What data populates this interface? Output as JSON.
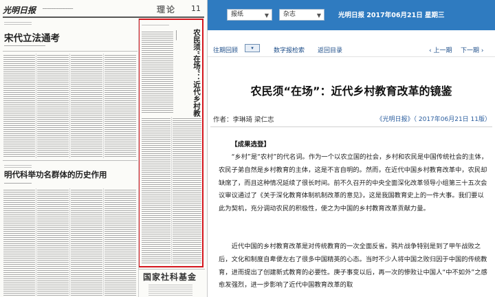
{
  "newspaper": {
    "masthead": "光明日报",
    "section": "理论",
    "page_no": "11",
    "headline_1": "宋代立法通考",
    "headline_2": "明代科举功名群体的历史作用",
    "highlight_title": "农民须“在场”：近代乡村教育改革的镜鉴",
    "ad": "国家社科基金"
  },
  "toolbar": {
    "paper_select": "报纸",
    "type_select": "杂志",
    "date_line": "光明日报  2017年06月21日  星期三"
  },
  "nav": {
    "back_label": "往期回顾",
    "period_icon": "▾",
    "search_label": "数字报检索",
    "catalog_label": "返回目录",
    "prev_label": "‹ 上一期",
    "next_label": "下一期 ›"
  },
  "article": {
    "title": "农民须“在场”：近代乡村教育改革的镜鉴",
    "authors": "作者：李琳琦  梁仁志",
    "source": "《光明日报》（ 2017年06月21日  11版）",
    "section_tag": "【成果选登】",
    "paragraphs": [
      "“乡村”是“农村”的代名词。作为一个以农立国的社会，乡村和农民是中国传统社会的主体，农民子弟自然是乡村教育的主体，这是不言自明的。然而，在近代中国乡村教育改革中，农民却缺席了，而且这种情况延续了很长时间。前不久召开的中央全面深化改革领导小组第三十五次会议审议通过了《关于深化教育体制机制改革的意见》，这是我国教育史上的一件大事。我们要以此为契机，充分调动农民的积极性，使之为中国的乡村教育改革贡献力量。",
      "近代中国的乡村教育改革是对传统教育的一次全面反省。鸦片战争特别是到了甲午战败之后，文化和制度自卑便左右了很多中国精英的心态。当时不少人将中国之败归因于中国的传统教育，进而提出了创建新式教育的必要性。庚子事变以后，再一次的惨败让中国人“中不如外”之感愈发强烈，进一步影响了近代中国教育改革的取"
    ]
  },
  "colors": {
    "topbar": "#2f7bc0",
    "highlight_box": "#d4141c",
    "link": "#1f4f8a"
  }
}
